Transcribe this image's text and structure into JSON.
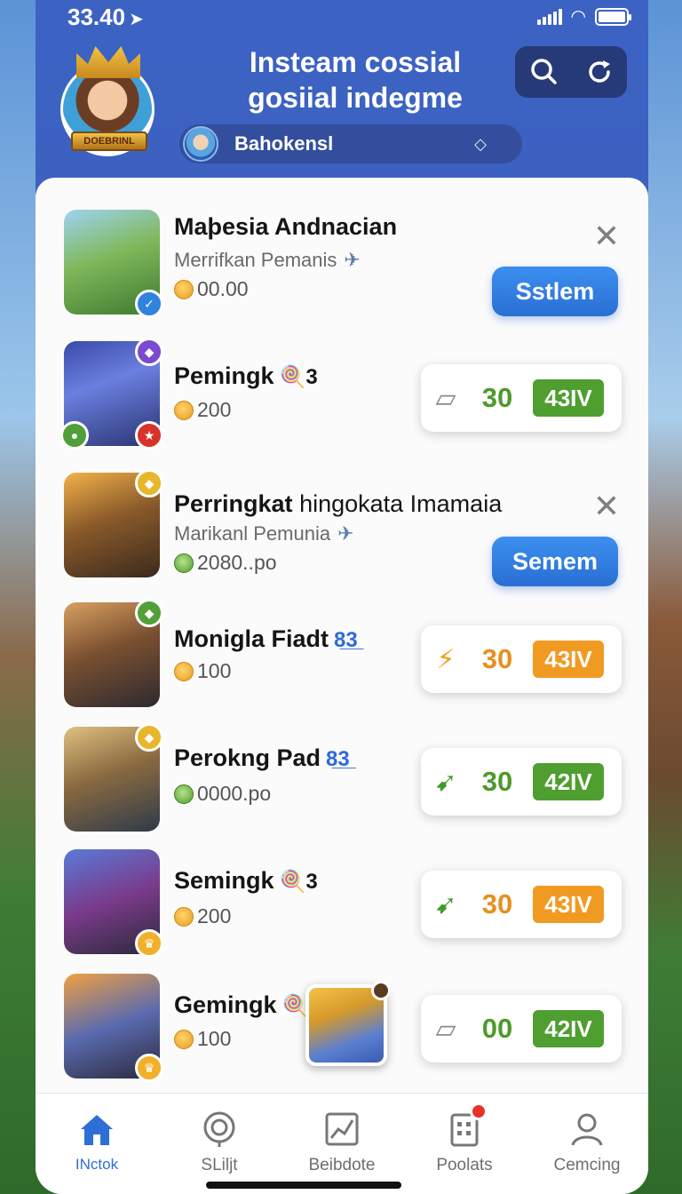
{
  "status": {
    "time": "33.40",
    "arrow": "➤"
  },
  "header": {
    "title_line1": "Insteam cossial",
    "title_line2": "gosiial indegme",
    "avatar_banner": "DOEBRINL",
    "search_text": "Bahokensl"
  },
  "rows": [
    {
      "name": "Maþesia Andnacian",
      "sub": "Merrifkan Pemanis",
      "coin": "00.00",
      "coin_color": "orange",
      "action": "Sstlem"
    },
    {
      "name": "Pemingk",
      "tag": "🍭3",
      "coin": "200",
      "coin_color": "orange",
      "score": "30",
      "pill": "43IV",
      "score_color": "green",
      "icon": "clipboard"
    },
    {
      "name": "Perringkat",
      "name_rest": "hingokata Imamaia",
      "sub": "Marikanl Pemunia",
      "coin": "2080..po",
      "coin_color": "green",
      "action": "Semem"
    },
    {
      "name": "Moniglа Fiadt",
      "tag": "8̲3̲",
      "coin": "100",
      "coin_color": "orange",
      "score": "30",
      "pill": "43IV",
      "score_color": "orange",
      "icon": "bolt"
    },
    {
      "name": "Perоkng Pad",
      "tag": "8̲3̲",
      "coin": "0000.po",
      "coin_color": "green",
      "score": "30",
      "pill": "42IV",
      "score_color": "green",
      "icon": "leaf"
    },
    {
      "name": "Semingk",
      "tag": "🍭3",
      "coin": "200",
      "coin_color": "orange",
      "score": "30",
      "pill": "43IV",
      "score_color": "orange",
      "icon": "leaf"
    },
    {
      "name": "Gemingk",
      "tag": "🍭3",
      "coin": "100",
      "coin_color": "orange",
      "score": "00",
      "pill": "42IV",
      "score_color": "green",
      "icon": "clipboard"
    }
  ],
  "tabs": [
    {
      "label": "INctok",
      "icon": "home-icon"
    },
    {
      "label": "SLiljt",
      "icon": "target-icon"
    },
    {
      "label": "Beibdote",
      "icon": "chart-icon"
    },
    {
      "label": "Poolats",
      "icon": "clipboard-icon"
    },
    {
      "label": "Cemcing",
      "icon": "profile-icon"
    }
  ],
  "colors": {
    "header": "#3c63c4",
    "accent_blue": "#2a6fd3",
    "green": "#4e9e30",
    "orange": "#f19a22"
  }
}
